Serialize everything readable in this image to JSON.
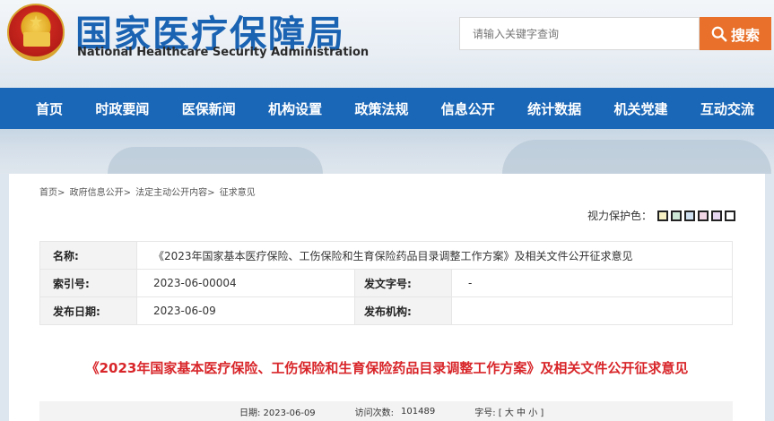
{
  "header": {
    "title_cn": "国家医疗保障局",
    "title_en": "National Healthcare Security Administration",
    "search_placeholder": "请输入关键字查询",
    "search_button": "搜索"
  },
  "nav": [
    "首页",
    "时政要闻",
    "医保新闻",
    "机构设置",
    "政策法规",
    "信息公开",
    "统计数据",
    "机关党建",
    "互动交流"
  ],
  "breadcrumb": [
    "首页>",
    "政府信息公开>",
    "法定主动公开内容>",
    "征求意见"
  ],
  "eye_protection": {
    "label": "视力保护色：",
    "colors": [
      "#f7f1c4",
      "#cfe9d7",
      "#cfe0f1",
      "#f3d7e6",
      "#e6d6ef",
      "#ffffff"
    ]
  },
  "meta": {
    "name_label": "名称:",
    "name_value": "《2023年国家基本医疗保险、工伤保险和生育保险药品目录调整工作方案》及相关文件公开征求意见",
    "index_label": "索引号:",
    "index_value": "2023-06-00004",
    "doc_no_label": "发文字号:",
    "doc_no_value": "-",
    "date_label": "发布日期:",
    "date_value": "2023-06-09",
    "org_label": "发布机构:",
    "org_value": ""
  },
  "article_title": "《2023年国家基本医疗保险、工伤保险和生育保险药品目录调整工作方案》及相关文件公开征求意见",
  "info_bar": {
    "date": "日期: 2023-06-09",
    "views_label": "访问次数:",
    "views_value": "101489",
    "font_size": "字号: [ 大 中 小 ]"
  }
}
